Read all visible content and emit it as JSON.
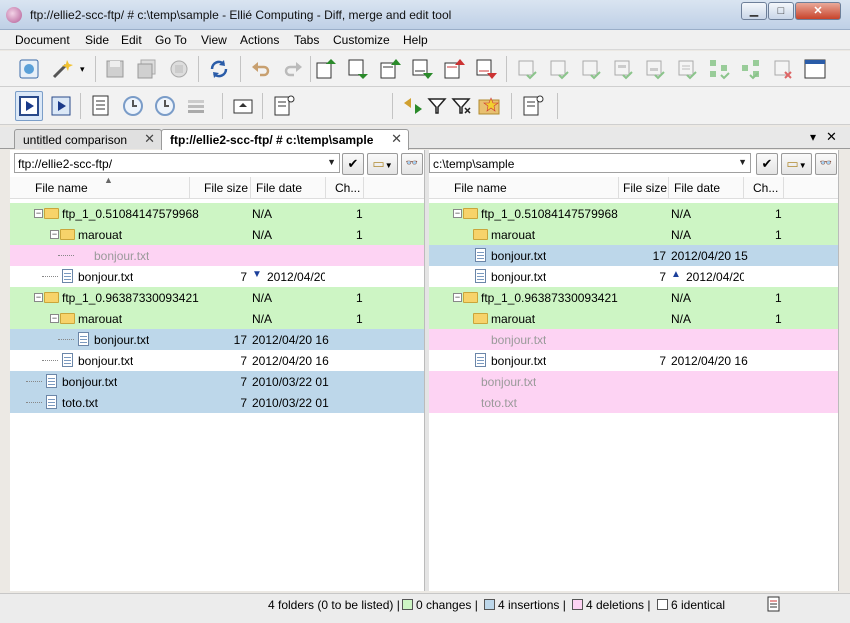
{
  "window": {
    "title": "ftp://ellie2-scc-ftp/ # c:\\temp\\sample - Ellié Computing - Diff, merge and edit tool",
    "minimize_glyph": "▁",
    "maximize_glyph": "□",
    "close_glyph": "✕"
  },
  "menu": {
    "items": [
      "Document",
      "Side",
      "Edit",
      "Go To",
      "View",
      "Actions",
      "Tabs",
      "Customize",
      "Help"
    ]
  },
  "tabs": [
    {
      "label": "untitled comparison",
      "close": "✕",
      "active": false
    },
    {
      "label": "ftp://ellie2-scc-ftp/ # c:\\temp\\sample",
      "close": "✕",
      "active": true
    }
  ],
  "tab_controls": {
    "menu_glyph": "▾",
    "close_glyph": "✕"
  },
  "left_pane": {
    "path": "ftp://ellie2-scc-ftp/",
    "columns": [
      "File name",
      "File size",
      "File date",
      "Ch..."
    ],
    "rows": [
      {
        "kind": "folder",
        "status": "changes",
        "name": "ftp_1_0.51084147579968",
        "size": "",
        "date": "N/A",
        "ch": "1"
      },
      {
        "kind": "folder",
        "status": "changes",
        "name": "marouat",
        "size": "",
        "date": "N/A",
        "ch": "1"
      },
      {
        "kind": "ghost",
        "status": "delete",
        "name": "bonjour.txt",
        "size": "",
        "date": "",
        "ch": ""
      },
      {
        "kind": "file",
        "status": "identical",
        "name": "bonjour.txt",
        "size": "7",
        "date": "2012/04/20",
        "ch": "",
        "arrow": "🡇"
      },
      {
        "kind": "folder",
        "status": "changes",
        "name": "ftp_1_0.96387330093421",
        "size": "",
        "date": "N/A",
        "ch": "1"
      },
      {
        "kind": "folder",
        "status": "changes",
        "name": "marouat",
        "size": "",
        "date": "N/A",
        "ch": "1"
      },
      {
        "kind": "file",
        "status": "insert",
        "name": "bonjour.txt",
        "size": "17",
        "date": "2012/04/20 16",
        "ch": ""
      },
      {
        "kind": "file",
        "status": "identical",
        "name": "bonjour.txt",
        "size": "7",
        "date": "2012/04/20 16",
        "ch": ""
      },
      {
        "kind": "file",
        "status": "insert",
        "name": "bonjour.txt",
        "size": "7",
        "date": "2010/03/22 01",
        "ch": ""
      },
      {
        "kind": "file",
        "status": "insert",
        "name": "toto.txt",
        "size": "7",
        "date": "2010/03/22 01",
        "ch": ""
      }
    ]
  },
  "right_pane": {
    "path": "c:\\temp\\sample",
    "columns": [
      "File name",
      "File size",
      "File date",
      "Ch..."
    ],
    "rows": [
      {
        "kind": "folder",
        "status": "changes",
        "name": "ftp_1_0.51084147579968",
        "size": "",
        "date": "N/A",
        "ch": "1"
      },
      {
        "kind": "folder",
        "status": "changes",
        "name": "marouat",
        "size": "",
        "date": "N/A",
        "ch": "1"
      },
      {
        "kind": "file",
        "status": "insert",
        "name": "bonjour.txt",
        "size": "17",
        "date": "2012/04/20 15",
        "ch": ""
      },
      {
        "kind": "file",
        "status": "identical",
        "name": "bonjour.txt",
        "size": "7",
        "date": "2012/04/20",
        "ch": "",
        "arrow": "🡅"
      },
      {
        "kind": "folder",
        "status": "changes",
        "name": "ftp_1_0.96387330093421",
        "size": "",
        "date": "N/A",
        "ch": "1"
      },
      {
        "kind": "folder",
        "status": "changes",
        "name": "marouat",
        "size": "",
        "date": "N/A",
        "ch": "1"
      },
      {
        "kind": "ghost",
        "status": "delete",
        "name": "bonjour.txt",
        "size": "",
        "date": "",
        "ch": ""
      },
      {
        "kind": "file",
        "status": "identical",
        "name": "bonjour.txt",
        "size": "7",
        "date": "2012/04/20 16",
        "ch": ""
      },
      {
        "kind": "ghost",
        "status": "delete",
        "name": "bonjour.txt",
        "size": "",
        "date": "",
        "ch": ""
      },
      {
        "kind": "ghost",
        "status": "delete",
        "name": "toto.txt",
        "size": "",
        "date": "",
        "ch": ""
      }
    ]
  },
  "statusbar": {
    "summary": "4 folders (0 to be listed) |",
    "changes": "0 changes |",
    "insertions": "4 insertions |",
    "deletions": "4 deletions |",
    "identical": "6 identical"
  },
  "colors": {
    "changes": "#cdf5c4",
    "insert": "#bdd7ea",
    "delete": "#fdd3f3",
    "identical": "#ffffff"
  },
  "icons": {
    "checkmark": "✔",
    "glasses": "👓"
  }
}
